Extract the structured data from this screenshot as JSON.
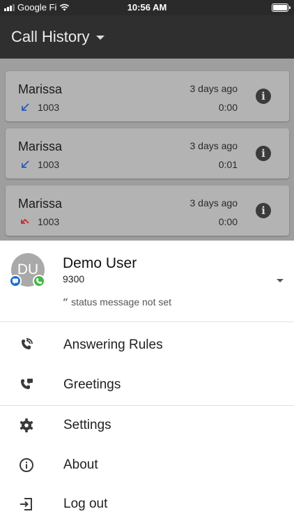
{
  "status_bar": {
    "carrier": "Google Fi",
    "time": "10:56 AM"
  },
  "app_bar": {
    "title": "Call History"
  },
  "calls": [
    {
      "name": "Marissa",
      "when": "3 days ago",
      "number": "1003",
      "duration": "0:00",
      "direction": "incoming",
      "icon_color": "#2b58b8"
    },
    {
      "name": "Marissa",
      "when": "3 days ago",
      "number": "1003",
      "duration": "0:01",
      "direction": "incoming",
      "icon_color": "#2b58b8"
    },
    {
      "name": "Marissa",
      "when": "3 days ago",
      "number": "1003",
      "duration": "0:00",
      "direction": "missed",
      "icon_color": "#c62828"
    }
  ],
  "drawer": {
    "user": {
      "initials": "DU",
      "name": "Demo User",
      "extension": "9300",
      "status_message": "status message not set"
    },
    "menu": [
      {
        "label": "Answering Rules",
        "icon": "answering-rules-icon"
      },
      {
        "label": "Greetings",
        "icon": "greetings-icon"
      },
      {
        "label": "Settings",
        "icon": "gear-icon"
      },
      {
        "label": "About",
        "icon": "info-icon"
      },
      {
        "label": "Log out",
        "icon": "logout-icon"
      }
    ]
  },
  "colors": {
    "app_bar": "#2f2f2f",
    "chat_badge": "#1b6fd1",
    "phone_badge": "#45b649"
  }
}
